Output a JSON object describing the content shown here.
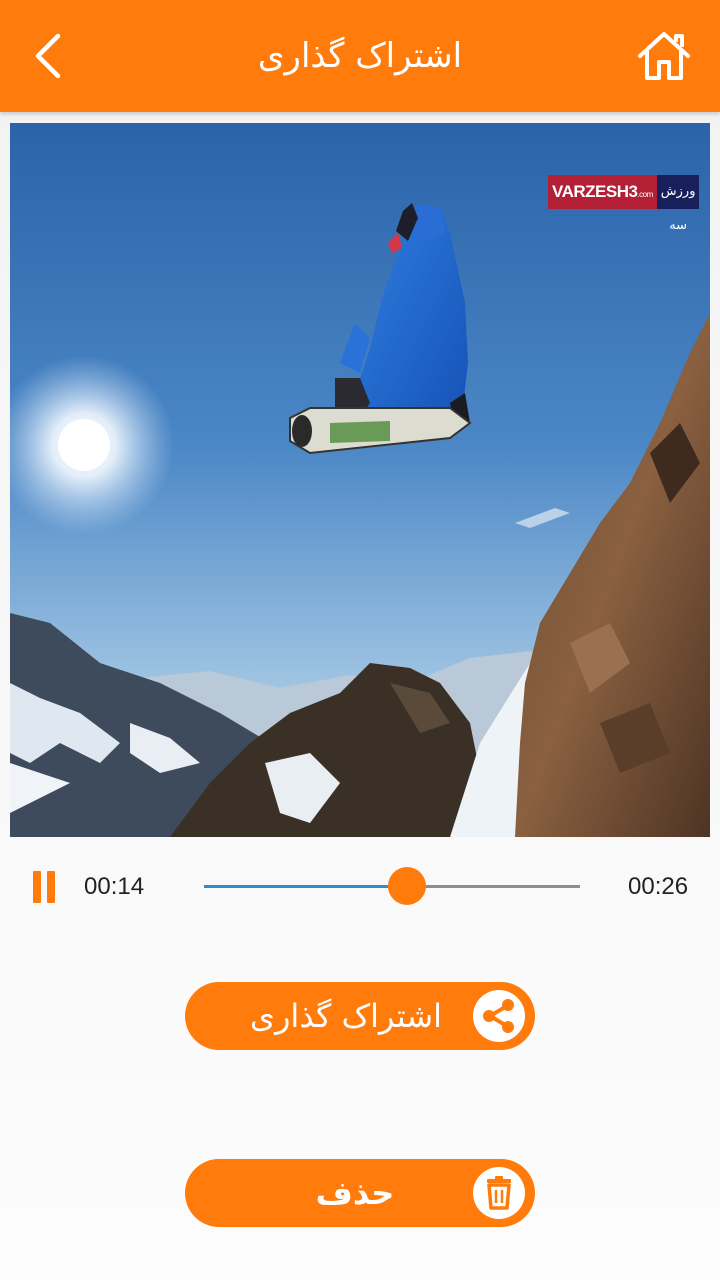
{
  "header": {
    "title": "اشتراک گذاری",
    "back_icon": "chevron-left-icon",
    "home_icon": "home-icon",
    "background_color": "#ff7b0b"
  },
  "video": {
    "watermark": {
      "brand": "VARZESH3",
      "suffix": ".com",
      "persian": "ورزش سه"
    }
  },
  "player": {
    "state_icon": "pause-icon",
    "current_time": "00:14",
    "total_time": "00:26",
    "progress": 0.54,
    "accent_color": "#ff7b0b",
    "track_fill_color": "#2c8ec9"
  },
  "actions": {
    "share": {
      "label": "اشتراک گذاری",
      "icon": "share-icon"
    },
    "delete": {
      "label": "حذف",
      "icon": "trash-icon"
    }
  }
}
